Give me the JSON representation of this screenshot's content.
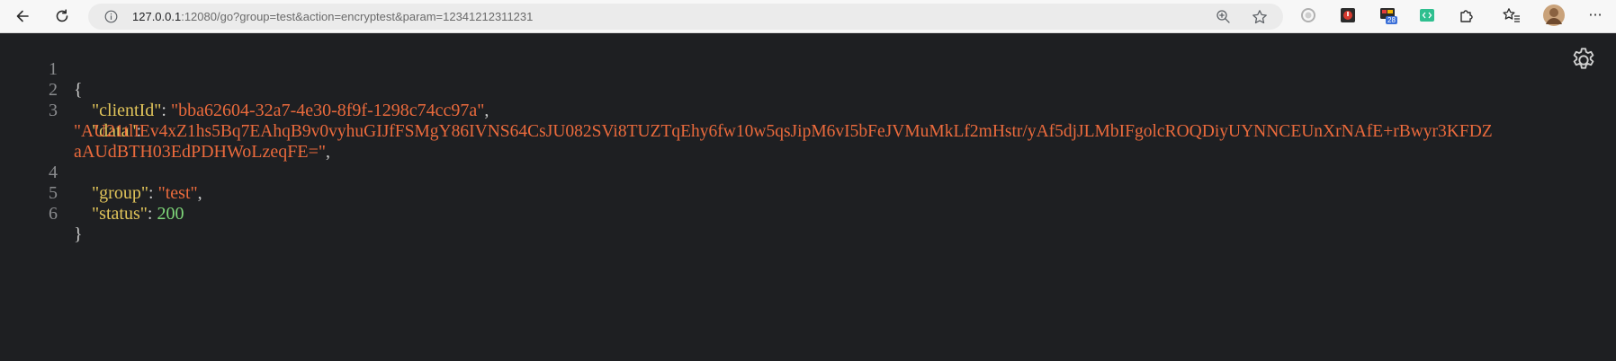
{
  "browser": {
    "url_host": "127.0.0.1",
    "url_rest": ":12080/go?group=test&action=encryptest&param=12341212311231",
    "extensions": [
      {
        "name": "circle-extension-icon"
      },
      {
        "name": "recorder-extension-icon",
        "badge": "28"
      },
      {
        "name": "code-extension-icon"
      },
      {
        "name": "puzzle-icon"
      },
      {
        "name": "favorites-icon"
      },
      {
        "name": "profile-avatar"
      }
    ],
    "more_label": "···"
  },
  "json_viewer": {
    "line_numbers": [
      "1",
      "2",
      "3",
      "4",
      "5",
      "6"
    ],
    "lines": {
      "open_brace": "{",
      "close_brace": "}",
      "indent": "    ",
      "clientId_key": "\"clientId\"",
      "clientId_value": "\"bba62604-32a7-4e30-8f9f-1298c74cc97a\"",
      "data_key": "\"data\"",
      "data_value_part1": "\"AU21tlIEv4xZ1hs5Bq7EAhqB9v0vyhuGIJfFSMgY86IVNS64CsJU082SVi8TUZTqEhy6fw10w5qsJipM6vI5bFeJVMuMkLf2mHstr/yAf5djJLMbIFgolcROQDiyUYNNCEUnXrNAfE+rBwyr3KFDZ",
      "data_value_part2": "aAUdBTH03EdPDHWoLzeqFE=\"",
      "group_key": "\"group\"",
      "group_value": "\"test\"",
      "status_key": "\"status\"",
      "status_value": "200"
    },
    "colon": ": ",
    "comma": ","
  },
  "colors": {
    "background": "#1e1f22",
    "key": "#e1c45a",
    "string": "#ea6a3c",
    "number": "#7fd87a",
    "line_number": "#8b8c8f"
  }
}
